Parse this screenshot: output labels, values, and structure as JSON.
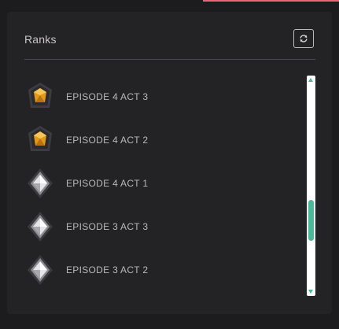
{
  "panel": {
    "title": "Ranks",
    "refresh_icon": "refresh-icon"
  },
  "ranks": [
    {
      "label": "EPISODE 4 ACT 3",
      "tier": "gold"
    },
    {
      "label": "EPISODE 4 ACT 2",
      "tier": "gold"
    },
    {
      "label": "EPISODE 4 ACT 1",
      "tier": "silver"
    },
    {
      "label": "EPISODE 3 ACT 3",
      "tier": "silver"
    },
    {
      "label": "EPISODE 3 ACT 2",
      "tier": "silver"
    }
  ],
  "colors": {
    "accent": "#49b89b",
    "top_accent": "#e8657a",
    "gold": "#e39a1c",
    "silver": "#cfcfd2"
  }
}
